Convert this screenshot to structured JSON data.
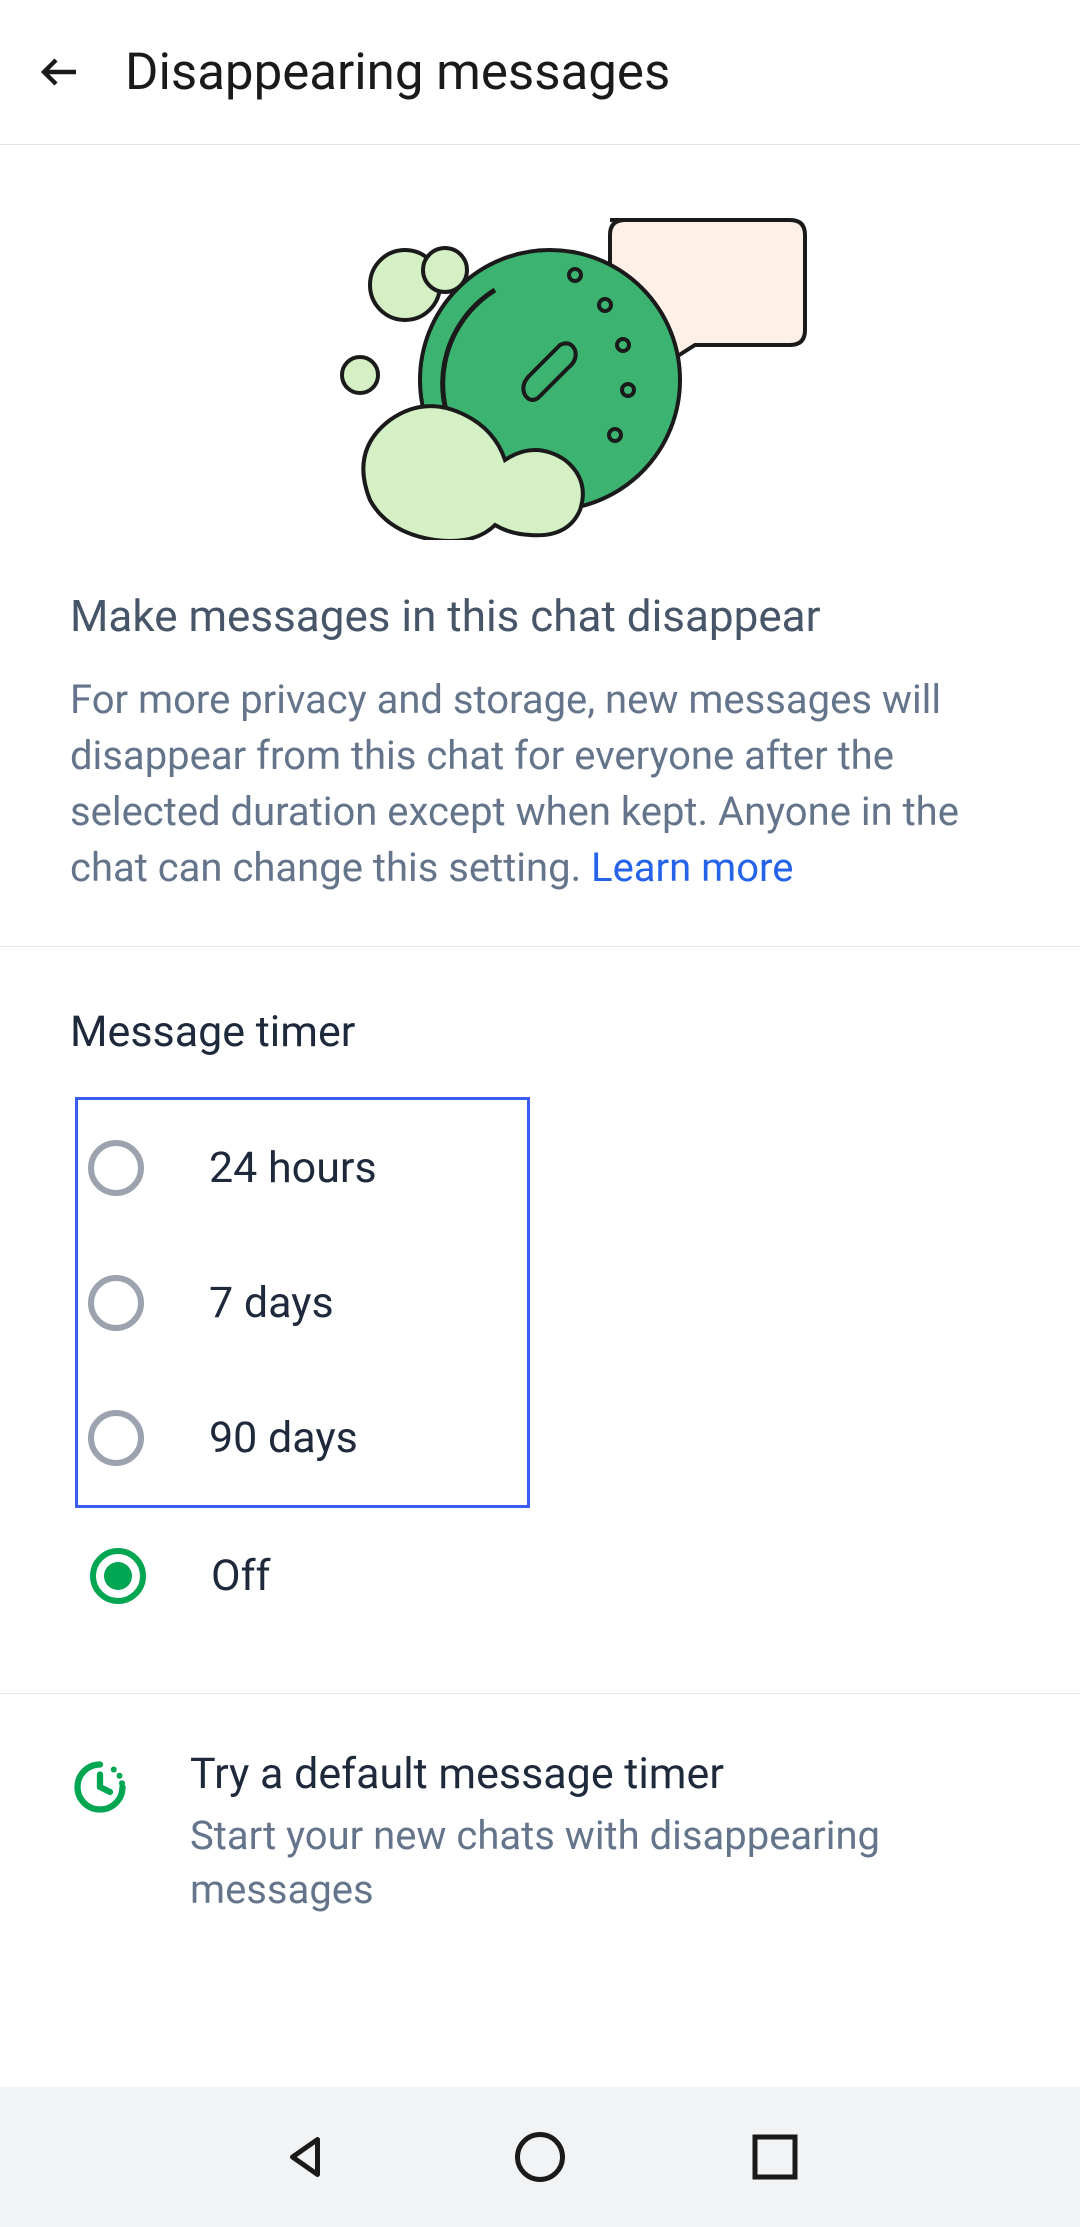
{
  "header": {
    "title": "Disappearing messages"
  },
  "intro": {
    "title": "Make messages in this chat disappear",
    "description": "For more privacy and storage, new messages will disappear from this chat for everyone after the selected duration except when kept. Anyone in the chat can change this setting. ",
    "learn_more": "Learn more"
  },
  "timer": {
    "title": "Message timer",
    "options": [
      {
        "label": "24 hours",
        "selected": false
      },
      {
        "label": "7 days",
        "selected": false
      },
      {
        "label": "90 days",
        "selected": false
      },
      {
        "label": "Off",
        "selected": true
      }
    ]
  },
  "default_timer": {
    "title": "Try a default message timer",
    "subtitle": "Start your new chats with disappearing messages"
  }
}
